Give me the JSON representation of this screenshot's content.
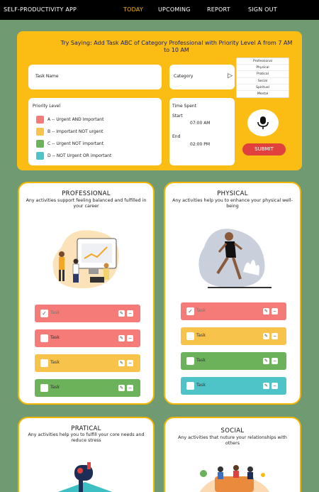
{
  "nav": {
    "brand": "SELF-PRODUCTIVITY APP",
    "links": [
      "TODAY",
      "UPCOMING",
      "REPORT",
      "SIGN OUT"
    ],
    "active": "TODAY"
  },
  "voice": {
    "hint": "Try Saying: Add Task ABC of Category Professional with Priority Level A from 7 AM to 10 AM",
    "task_name_label": "Task Name",
    "category_label": "Category",
    "category_options": [
      "Professional",
      "Physical",
      "Pratical",
      "Social",
      "Spiritual",
      "Mental"
    ],
    "priority_title": "Priority Level",
    "priorities": [
      {
        "text": "A -- Urgent AND Important",
        "color": "#f47b77"
      },
      {
        "text": "B -- Important NOT urgent",
        "color": "#f7c34b"
      },
      {
        "text": "C -- Urgent NOT important",
        "color": "#6bb25a"
      },
      {
        "text": "D -- NOT Urgent OR important",
        "color": "#4ec4c8"
      }
    ],
    "time_spent_label": "Time Spent",
    "start_label": "Start",
    "start_value": "07:00 AM",
    "end_label": "End",
    "end_value": "02:00 PM",
    "submit_label": "SUBMIT"
  },
  "cards": [
    {
      "title": "PROFESSIONAL",
      "desc": "Any activities support feeling balanced and fulfilled in your career"
    },
    {
      "title": "PHYSICAL",
      "desc": "Any activities help you to enhance your physical well-being"
    },
    {
      "title": "PRATICAL",
      "desc": "Any activities help you to fulfill your core needs and reduce stress"
    },
    {
      "title": "SOCIAL",
      "desc": "Any activities that nuture your relationships with others"
    }
  ],
  "task_label": "Task",
  "colors": {
    "accent": "#fbbd13",
    "background": "#6f9a72",
    "submit": "#e0413d",
    "card_border": "#f2b500"
  }
}
